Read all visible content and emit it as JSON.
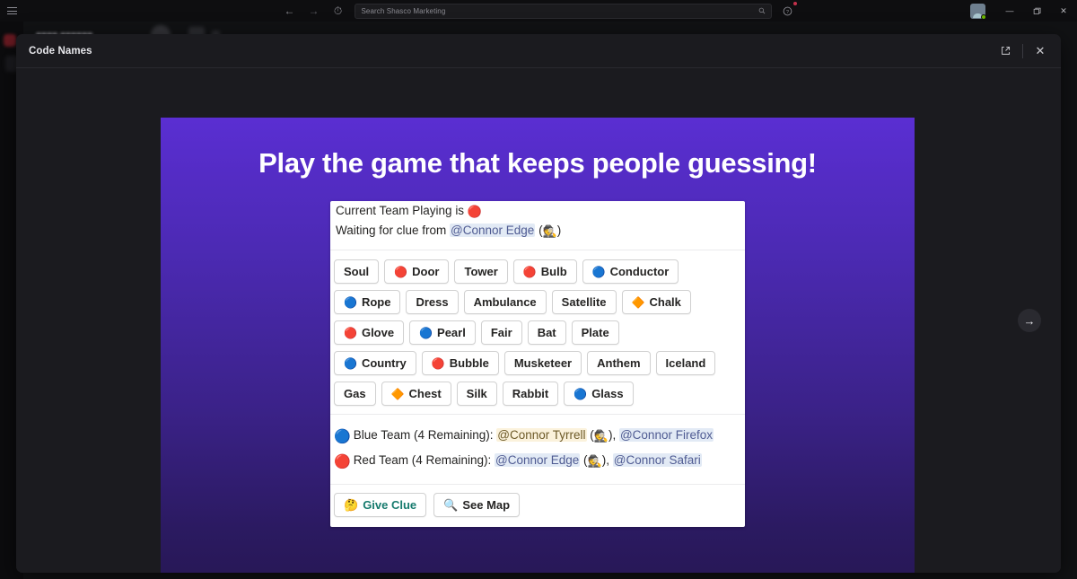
{
  "titlebar": {
    "menu_icon": "hamburger-icon",
    "back_icon": "arrow-left-icon",
    "forward_icon": "arrow-right-icon",
    "history_icon": "clock-icon",
    "search": {
      "placeholder": "Search Shasco Marketing",
      "value": "",
      "icon": "search-icon"
    },
    "help_icon": "help-circle-icon",
    "avatar_label": "",
    "minimize_label": "—",
    "maximize_label": "❐",
    "close_label": "✕"
  },
  "modal": {
    "title": "Code Names",
    "popout_label": "↗",
    "close_label": "✕"
  },
  "game": {
    "banner_title": "Play the game that keeps people guessing!",
    "status": {
      "line1_prefix": "Current Team Playing is ",
      "line1_emoji": "🔴",
      "line2_prefix": "Waiting for clue from ",
      "line2_mention": "@Connor Edge",
      "line2_open": " (",
      "line2_emoji": "🕵️",
      "line2_close": ")"
    },
    "grid": [
      [
        {
          "label": "Soul",
          "marker": ""
        },
        {
          "label": "Door",
          "marker": "🔴"
        },
        {
          "label": "Tower",
          "marker": ""
        },
        {
          "label": "Bulb",
          "marker": "🔴"
        },
        {
          "label": "Conductor",
          "marker": "🔵"
        }
      ],
      [
        {
          "label": "Rope",
          "marker": "🔵"
        },
        {
          "label": "Dress",
          "marker": ""
        },
        {
          "label": "Ambulance",
          "marker": ""
        },
        {
          "label": "Satellite",
          "marker": ""
        },
        {
          "label": "Chalk",
          "marker": "🔶"
        }
      ],
      [
        {
          "label": "Glove",
          "marker": "🔴"
        },
        {
          "label": "Pearl",
          "marker": "🔵"
        },
        {
          "label": "Fair",
          "marker": ""
        },
        {
          "label": "Bat",
          "marker": ""
        },
        {
          "label": "Plate",
          "marker": ""
        }
      ],
      [
        {
          "label": "Country",
          "marker": "🔵"
        },
        {
          "label": "Bubble",
          "marker": "🔴"
        },
        {
          "label": "Musketeer",
          "marker": ""
        },
        {
          "label": "Anthem",
          "marker": ""
        },
        {
          "label": "Iceland",
          "marker": ""
        }
      ],
      [
        {
          "label": "Gas",
          "marker": ""
        },
        {
          "label": "Chest",
          "marker": "🔶"
        },
        {
          "label": "Silk",
          "marker": ""
        },
        {
          "label": "Rabbit",
          "marker": ""
        },
        {
          "label": "Glass",
          "marker": "🔵"
        }
      ]
    ],
    "teams": [
      {
        "ball": "🔵",
        "name": "Blue Team",
        "remaining_text": " (4 Remaining): ",
        "spymaster": "@Connor Tyrrell",
        "spy_open": " (",
        "spy_emoji": "🕵️",
        "spy_close": "), ",
        "operative": "@Connor Firefox"
      },
      {
        "ball": "🔴",
        "name": "Red Team",
        "remaining_text": " (4 Remaining): ",
        "spymaster": "@Connor Edge",
        "spy_open": " (",
        "spy_emoji": "🕵️",
        "spy_close": "), ",
        "operative": "@Connor Safari"
      }
    ],
    "actions": [
      {
        "emoji": "🤔",
        "label": "Give Clue",
        "accent": true
      },
      {
        "emoji": "🔍",
        "label": "See Map",
        "accent": false
      }
    ],
    "next_label": "→"
  },
  "colors": {
    "banner_top": "#5a2ed2",
    "banner_bottom": "#271755",
    "accent_green": "#177b6e",
    "mention_blue_bg": "#e2eaf5",
    "mention_blue_fg": "#4f5b92",
    "mention_warm_bg": "#fbf2dc",
    "red_team": "#d03a33",
    "blue_team": "#2a6fd6"
  }
}
